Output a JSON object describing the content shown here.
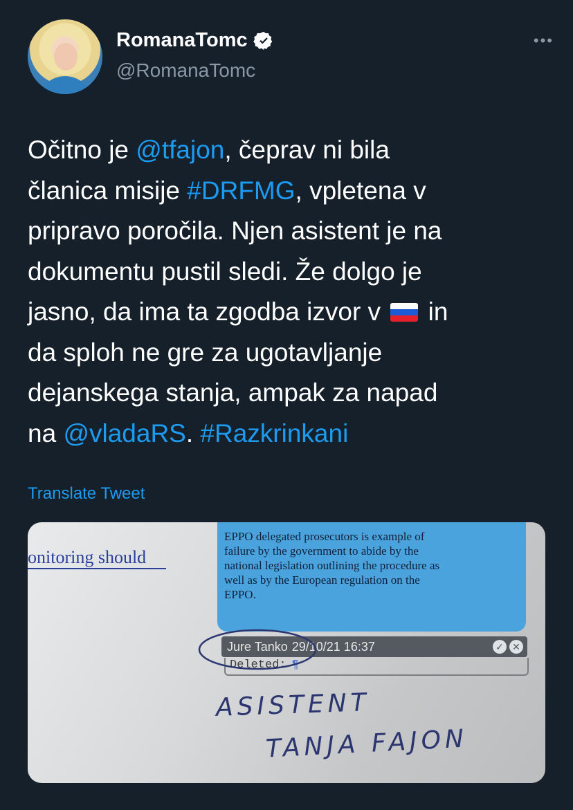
{
  "author": {
    "display_name": "RomanaTomc",
    "handle": "@RomanaTomc",
    "verified_icon": "verified-badge-icon",
    "more_icon": "more-options-icon"
  },
  "tweet": {
    "segments": [
      {
        "text": "Očitno je ",
        "type": "text"
      },
      {
        "text": "@tfajon",
        "type": "mention"
      },
      {
        "text": ", čeprav ni bila\nčlanica misije ",
        "type": "text"
      },
      {
        "text": "#DRFMG",
        "type": "hashtag"
      },
      {
        "text": ", vpletena v\npripravo poročila. Njen asistent je na\ndokumentu pustil sledi. Že dolgo je\njasno, da ima ta zgodba izvor v ",
        "type": "text"
      },
      {
        "text": "slovenia-flag",
        "type": "flag"
      },
      {
        "text": " in\nda sploh ne gre za ugotavljanje\ndejanskega stanja, ampak za napad\nna ",
        "type": "text"
      },
      {
        "text": "@vladaRS",
        "type": "mention"
      },
      {
        "text": ". ",
        "type": "text"
      },
      {
        "text": "#Razkrinkani",
        "type": "hashtag"
      }
    ],
    "translate_label": "Translate Tweet",
    "link_color": "#1d9bf0"
  },
  "media": {
    "doc_fragment": "onitoring should",
    "comment_lines": [
      "EPPO delegated prosecutors is example of",
      "failure by the government to abide by the",
      "national legislation outlining the procedure as",
      "well as by the European regulation on the",
      "EPPO."
    ],
    "comment_author": "Jure Tanko",
    "comment_date": "29/10/21 16:37",
    "deleted_label": "Deleted:",
    "deleted_mark": "¶",
    "handwriting_line1": "ASISTENT",
    "handwriting_line2": "TANJA FAJON"
  }
}
